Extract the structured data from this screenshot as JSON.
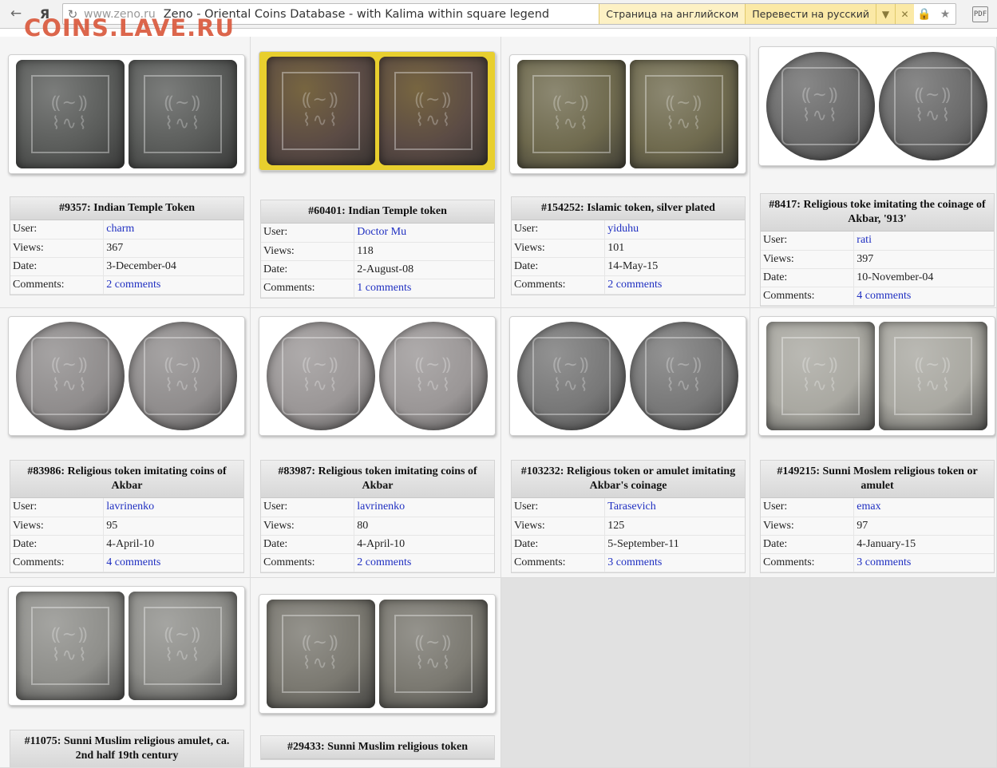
{
  "browser": {
    "url": "www.zeno.ru",
    "title": "Zeno - Oriental Coins Database - with Kalima within square legend",
    "translate_original": "Страница на английском",
    "translate_action": "Перевести на русский",
    "yandex_glyph": "Я",
    "back_glyph": "←",
    "ext_label": "PDF"
  },
  "watermark": "COINS.LAVE.RU",
  "labels": {
    "user": "User:",
    "views": "Views:",
    "date": "Date:",
    "comments": "Comments:"
  },
  "coins": [
    {
      "title": "#9357: Indian Temple Token",
      "user": "charm",
      "views": "367",
      "date": "3-December-04",
      "comments": "2 comments",
      "shape": "square",
      "color": "#5a5c5a"
    },
    {
      "title": "#60401: Indian Temple token",
      "user": "Doctor Mu",
      "views": "118",
      "date": "2-August-08",
      "comments": "1 comments",
      "shape": "square",
      "color": "#5b4b45"
    },
    {
      "title": "#154252: Islamic token, silver plated",
      "user": "yiduhu",
      "views": "101",
      "date": "14-May-15",
      "comments": "2 comments",
      "shape": "square",
      "color": "#6f6a4e"
    },
    {
      "title": "#8417: Religious toke imitating the coinage of Akbar, '913'",
      "user": "rati",
      "views": "397",
      "date": "10-November-04",
      "comments": "4 comments",
      "shape": "round",
      "color": "#6a6a6a"
    },
    {
      "title": "#83986: Religious token imitating coins of Akbar",
      "user": "lavrinenko",
      "views": "95",
      "date": "4-April-10",
      "comments": "4 comments",
      "shape": "round",
      "color": "#8f8c8c"
    },
    {
      "title": "#83987: Religious token imitating coins of Akbar",
      "user": "lavrinenko",
      "views": "80",
      "date": "4-April-10",
      "comments": "2 comments",
      "shape": "round",
      "color": "#9a9696"
    },
    {
      "title": "#103232: Religious token or amulet imitating Akbar's coinage",
      "user": "Tarasevich",
      "views": "125",
      "date": "5-September-11",
      "comments": "3 comments",
      "shape": "round",
      "color": "#777777"
    },
    {
      "title": "#149215: Sunni Moslem religious token or amulet",
      "user": "emax",
      "views": "97",
      "date": "4-January-15",
      "comments": "3 comments",
      "shape": "square",
      "color": "#a9a8a1"
    },
    {
      "title": "#11075: Sunni Muslim religious amulet, ca. 2nd half 19th century",
      "user": "",
      "views": "",
      "date": "",
      "comments": "",
      "shape": "square",
      "color": "#8e8e8a"
    },
    {
      "title": "#29433: Sunni Muslim religious token",
      "user": "",
      "views": "",
      "date": "",
      "comments": "",
      "shape": "square",
      "color": "#7a7870"
    }
  ]
}
